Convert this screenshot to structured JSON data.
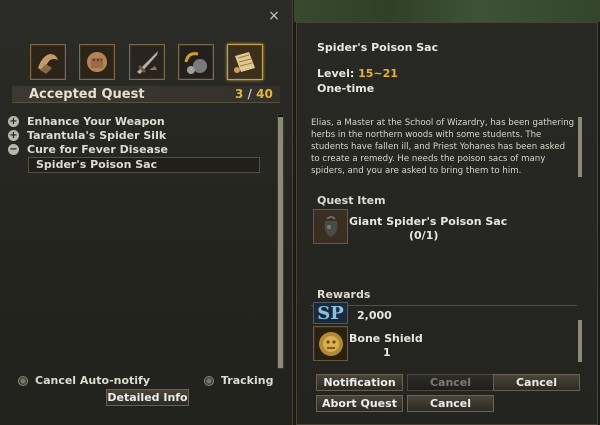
{
  "left": {
    "close_icon": "×",
    "categories": [
      {
        "name": "weapon-category-icon",
        "active": false
      },
      {
        "name": "fist-category-icon",
        "active": false
      },
      {
        "name": "sword-category-icon",
        "active": false
      },
      {
        "name": "gear-category-icon",
        "active": false
      },
      {
        "name": "scroll-category-icon",
        "active": true
      }
    ],
    "accepted_label": "Accepted Quest",
    "accepted_current": "3",
    "accepted_sep": "/",
    "accepted_max": "40",
    "quests": [
      {
        "toggle": "+",
        "label": "Enhance Your Weapon"
      },
      {
        "toggle": "+",
        "label": "Tarantula's Spider Silk"
      },
      {
        "toggle": "−",
        "label": "Cure for Fever Disease"
      }
    ],
    "selected_subquest": "Spider's Poison Sac",
    "cancel_auto_notify": "Cancel Auto-notify",
    "tracking": "Tracking",
    "detailed_info": "Detailed Info"
  },
  "right": {
    "title": "Spider's Poison Sac",
    "level_label": "Level:",
    "level_value": "15~21",
    "quest_type": "One-time",
    "description": "Elias, a Master at the School of Wizardry, has been gathering herbs in the northern woods with some students. The students have fallen ill, and Priest Yohanes has been asked to create a remedy. He needs the poison sacs of many spiders, and you are asked to bring them to him.",
    "quest_item_label": "Quest Item",
    "quest_item_name": "Giant Spider's Poison Sac",
    "quest_item_qty": "(0/1)",
    "rewards_label": "Rewards",
    "rewards": [
      {
        "icon": "sp-icon",
        "icon_text": "SP",
        "name": "",
        "qty": "2,000"
      },
      {
        "icon": "bone-shield-icon",
        "name": "Bone Shield",
        "qty": "1"
      }
    ],
    "buttons": {
      "notification": "Notification",
      "cancel_disabled": "Cancel",
      "cancel_top": "Cancel",
      "abort_quest": "Abort Quest",
      "cancel_bottom": "Cancel"
    }
  }
}
